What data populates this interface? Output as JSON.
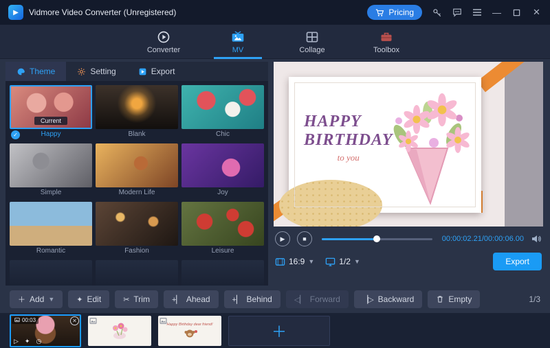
{
  "colors": {
    "accent": "#2ea1f5",
    "export_button": "#1a9bf5",
    "titlebar_bg": "#131a2b",
    "tape_orange": "#ec8b33"
  },
  "titlebar": {
    "title": "Vidmore Video Converter (Unregistered)",
    "pricing_label": "Pricing"
  },
  "nav": {
    "active": "MV",
    "tabs": [
      {
        "label": "Converter"
      },
      {
        "label": "MV"
      },
      {
        "label": "Collage"
      },
      {
        "label": "Toolbox"
      }
    ]
  },
  "left_panel": {
    "active_tab": "Theme",
    "tabs": [
      {
        "label": "Theme"
      },
      {
        "label": "Setting"
      },
      {
        "label": "Export"
      }
    ],
    "themes": [
      {
        "label": "Happy",
        "badge": "Current",
        "selected": true
      },
      {
        "label": "Blank"
      },
      {
        "label": "Chic"
      },
      {
        "label": "Simple"
      },
      {
        "label": "Modern Life"
      },
      {
        "label": "Joy"
      },
      {
        "label": "Romantic"
      },
      {
        "label": "Fashion"
      },
      {
        "label": "Leisure"
      }
    ]
  },
  "preview": {
    "card": {
      "line1": "HAPPY",
      "line2": "BIRTHDAY",
      "line3": "to you"
    },
    "time": "00:00:02.21/00:00:06.00",
    "progress": "50%",
    "aspect_ratio": "16:9",
    "screen_page": "1/2",
    "export_label": "Export"
  },
  "toolbar": {
    "add": "Add",
    "edit": "Edit",
    "trim": "Trim",
    "ahead": "Ahead",
    "behind": "Behind",
    "forward": "Forward",
    "backward": "Backward",
    "empty": "Empty",
    "counter": "1/3"
  },
  "timeline": {
    "clips": [
      {
        "duration": "00:03"
      },
      {
        "type": "image-card"
      },
      {
        "caption": "Happy Birthday dear friend!"
      }
    ]
  }
}
